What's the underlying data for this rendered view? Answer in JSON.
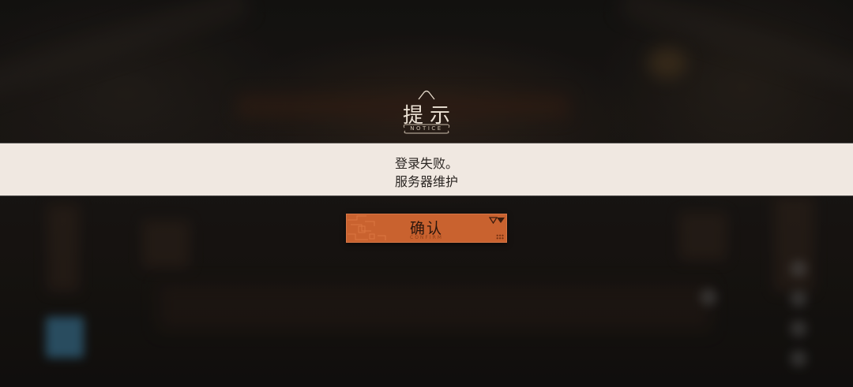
{
  "dialog": {
    "title": "提示",
    "title_subtitle": "NOTICE",
    "message_lines": [
      "登录失败。",
      "服务器维护"
    ],
    "confirm": {
      "label": "确认",
      "subtitle": "CONFIRM"
    }
  },
  "colors": {
    "band_background": "#f0e8e1",
    "confirm_button": "#c9622f",
    "title_text": "#ede3d6",
    "message_text": "#2a2522"
  },
  "icons": {
    "title_ornament": "arch-ornament-icon",
    "confirm_corner_outline": "triangle-outline-icon",
    "confirm_corner_solid": "triangle-solid-icon",
    "confirm_dots": "dot-grid-icon",
    "confirm_pattern": "circuit-pattern-icon"
  }
}
